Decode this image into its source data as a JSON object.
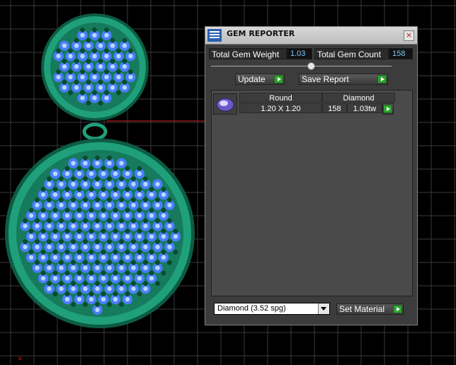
{
  "colors": {
    "metal": "#1fa07a",
    "metal_dark": "#0d5c44",
    "gem_blue": "#4a7dff",
    "gem_light": "#b8d8ff",
    "gem_green": "#0a4a2f",
    "grid": "#3a3a3a",
    "panel_bg": "#3c3c3c",
    "value_text": "#7cc8ff"
  },
  "dialog": {
    "title": "GEM REPORTER",
    "close_label": "×",
    "total_weight_label": "Total Gem Weight",
    "total_weight_value": "1.03",
    "total_count_label": "Total Gem Count",
    "total_count_value": "158",
    "update_label": "Update",
    "save_report_label": "Save Report",
    "table": {
      "headers": [
        "Round",
        "Diamond"
      ],
      "rows": [
        {
          "size": "1.20 X 1.20",
          "count": "158",
          "weight": "1.03tw"
        }
      ]
    },
    "material_select": {
      "selected": "Diamond      (3.52 spg)"
    },
    "set_material_label": "Set Material"
  }
}
